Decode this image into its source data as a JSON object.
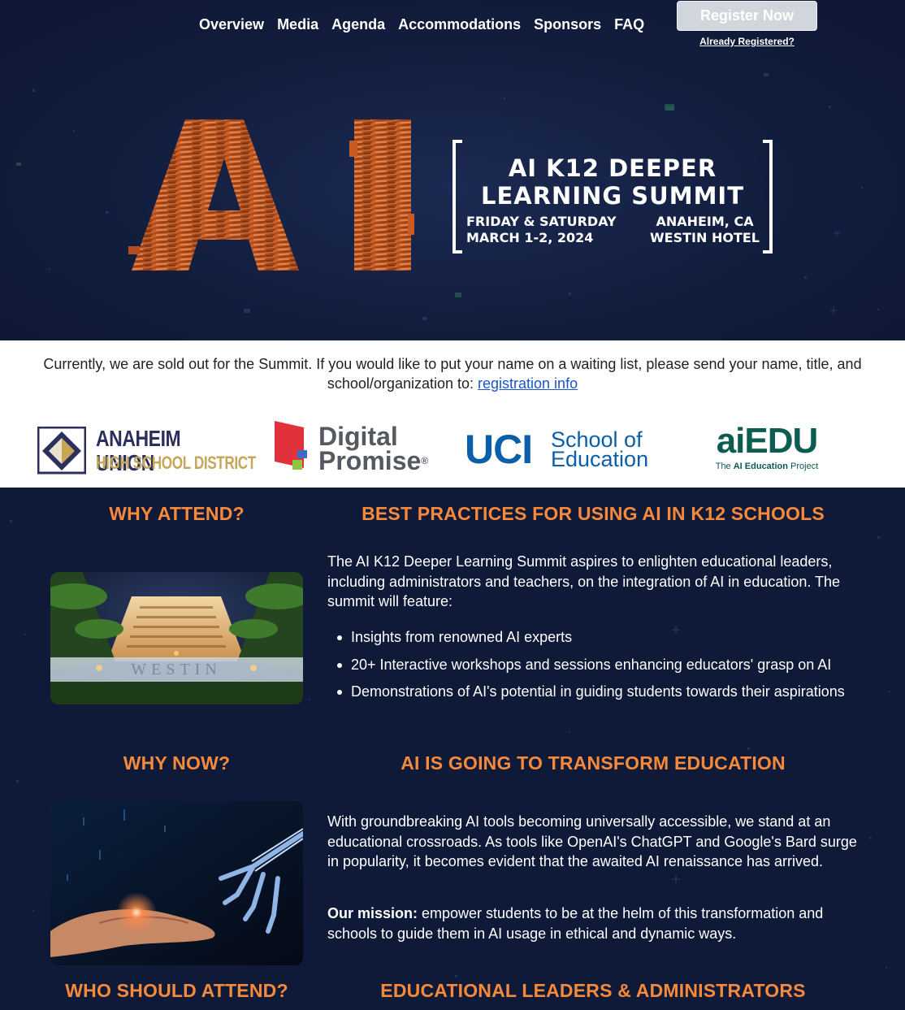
{
  "nav": {
    "items": [
      "Overview",
      "Media",
      "Agenda",
      "Accommodations",
      "Sponsors",
      "FAQ"
    ],
    "register_label": "Register Now",
    "already_label": "Already Registered?"
  },
  "hero": {
    "logo_text": "AI",
    "title_line1": "AI K12 DEEPER",
    "title_line2": "LEARNING SUMMIT",
    "date_line1": "FRIDAY & SATURDAY",
    "date_line2": "MARCH 1-2, 2024",
    "place_line1": "ANAHEIM, CA",
    "place_line2": "WESTIN HOTEL"
  },
  "notice": {
    "text": "Currently, we are sold out for the Summit.  If you would like to put your name on a waiting list, please send your name, title, and school/organization to: ",
    "link": "registration info"
  },
  "partners": {
    "anaheim_line1": "ANAHEIM UNION",
    "anaheim_line2": "HIGH SCHOOL DISTRICT",
    "dp_line1": "Digital",
    "dp_line2": "Promise",
    "dp_mark": "®",
    "uci_mark": "UCI",
    "uci_line1": "School of",
    "uci_line2": "Education",
    "aiedu_mark": "aiEDU",
    "aiedu_tag_pre": "The ",
    "aiedu_tag_bold": "AI Education",
    "aiedu_tag_post": " Project"
  },
  "sections": {
    "why_attend": "WHY ATTEND?",
    "best_practices": "BEST PRACTICES FOR USING AI IN K12 SCHOOLS",
    "intro": "The AI K12 Deeper Learning Summit aspires to enlighten educational leaders, including administrators and teachers, on the integration of AI in education.  The summit will feature:",
    "bullets": [
      "Insights from renowned AI experts",
      "20+ Interactive workshops and sessions enhancing educators' grasp on AI",
      "Demonstrations of AI's potential in guiding students towards their aspirations"
    ],
    "why_now": "WHY NOW?",
    "transform": "AI IS GOING TO TRANSFORM EDUCATION",
    "now_text": "With groundbreaking AI tools becoming universally accessible, we stand at an educational crossroads.  As tools like OpenAI's ChatGPT and Google's Bard surge in popularity, it becomes evident that the awaited AI renaissance has arrived.",
    "mission_label": "Our mission:",
    "mission_text": " empower students to be at the helm of this transformation and schools to guide them in AI usage in ethical and dynamic ways.",
    "who_attend": "WHO SHOULD ATTEND?",
    "leaders": "EDUCATIONAL LEADERS & ADMINISTRATORS",
    "hotel_sign": "WESTIN"
  },
  "colors": {
    "accent_orange": "#f7893b",
    "navy": "#101a36",
    "link_blue": "#1a55c9"
  }
}
